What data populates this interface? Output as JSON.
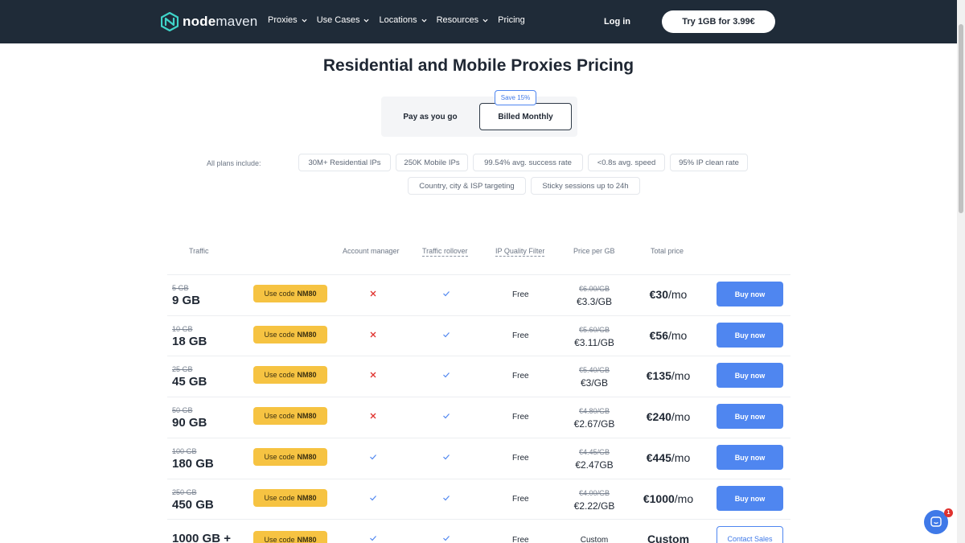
{
  "header": {
    "logo_bold": "node",
    "logo_light": "maven",
    "nav": [
      {
        "label": "Proxies",
        "has_dropdown": true
      },
      {
        "label": "Use Cases",
        "has_dropdown": true
      },
      {
        "label": "Locations",
        "has_dropdown": true
      },
      {
        "label": "Resources",
        "has_dropdown": true
      },
      {
        "label": "Pricing",
        "has_dropdown": false
      }
    ],
    "login_label": "Log in",
    "cta_label": "Try 1GB for 3.99€"
  },
  "page_title": "Residential and Mobile Proxies Pricing",
  "billing_toggle": {
    "option_1": "Pay as you go",
    "option_2": "Billed Monthly",
    "selected": "Billed Monthly",
    "save_badge": "Save 15%"
  },
  "features": {
    "label": "All plans include:",
    "chips": [
      "30M+ Residential IPs",
      "250K Mobile IPs",
      "99.54% avg. success rate",
      "<0.8s avg. speed",
      "95% IP clean rate",
      "Country, city & ISP targeting",
      "Sticky sessions up to 24h"
    ]
  },
  "table": {
    "headers": {
      "traffic": "Traffic",
      "account_manager": "Account manager",
      "traffic_rollover": "Traffic rollover",
      "ip_quality": "IP Quality Filter",
      "price_per_gb": "Price per GB",
      "total_price": "Total price"
    },
    "code_prefix": "Use code",
    "code": "NM80",
    "per_month": "/mo",
    "buy_label": "Buy now",
    "contact_label": "Contact Sales",
    "rows": [
      {
        "old_traffic": "5 GB",
        "traffic": "9 GB",
        "account_manager": false,
        "rollover": true,
        "ip_quality": "Free",
        "old_price": "€6.00/GB",
        "price": "€3.3/GB",
        "total": "€30"
      },
      {
        "old_traffic": "10 GB",
        "traffic": "18 GB",
        "account_manager": false,
        "rollover": true,
        "ip_quality": "Free",
        "old_price": "€5.60/GB",
        "price": "€3.11/GB",
        "total": "€56"
      },
      {
        "old_traffic": "25 GB",
        "traffic": "45 GB",
        "account_manager": false,
        "rollover": true,
        "ip_quality": "Free",
        "old_price": "€5.40/GB",
        "price": "€3/GB",
        "total": "€135"
      },
      {
        "old_traffic": "50 GB",
        "traffic": "90 GB",
        "account_manager": false,
        "rollover": true,
        "ip_quality": "Free",
        "old_price": "€4.80/GB",
        "price": "€2.67/GB",
        "total": "€240"
      },
      {
        "old_traffic": "100 GB",
        "traffic": "180 GB",
        "account_manager": true,
        "rollover": true,
        "ip_quality": "Free",
        "old_price": "€4.45/GB",
        "price": "€2.47GB",
        "total": "€445"
      },
      {
        "old_traffic": "250 GB",
        "traffic": "450 GB",
        "account_manager": true,
        "rollover": true,
        "ip_quality": "Free",
        "old_price": "€4.00/GB",
        "price": "€2.22/GB",
        "total": "€1000"
      }
    ],
    "custom_row": {
      "traffic": "1000 GB +",
      "account_manager": true,
      "rollover": true,
      "ip_quality": "Free",
      "price": "Custom",
      "total": "Custom"
    }
  },
  "chat": {
    "badge_count": "1"
  },
  "colors": {
    "header_bg": "#1f2b38",
    "accent": "#4f86f0",
    "code_badge": "#f6c342",
    "cross": "#e0322e",
    "check": "#4f86f0"
  }
}
